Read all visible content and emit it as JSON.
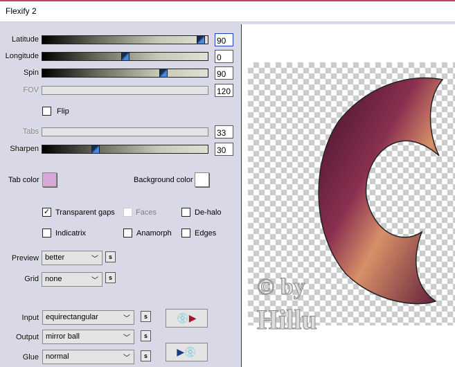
{
  "window": {
    "title": "Flexify 2"
  },
  "sliders": [
    {
      "label": "Latitude",
      "value": "90",
      "fraction": 0.98,
      "enabled": true
    },
    {
      "label": "Longitude",
      "value": "0",
      "fraction": 0.5,
      "enabled": true
    },
    {
      "label": "Spin",
      "value": "90",
      "fraction": 0.74,
      "enabled": true
    },
    {
      "label": "FOV",
      "value": "120",
      "enabled": false
    },
    {
      "label": "Tabs",
      "value": "33",
      "enabled": false
    },
    {
      "label": "Sharpen",
      "value": "30",
      "fraction": 0.31,
      "enabled": true
    }
  ],
  "flip": {
    "label": "Flip",
    "checked": false
  },
  "colors": {
    "tab_label": "Tab color",
    "tab_color": "#d8a8d8",
    "bg_label": "Background color",
    "bg_color": "#ffffff"
  },
  "checkboxes": [
    {
      "label": "Transparent gaps",
      "checked": true
    },
    {
      "label": "Faces",
      "checked": false,
      "disabled": true
    },
    {
      "label": "De-halo",
      "checked": false
    },
    {
      "label": "Indicatrix",
      "checked": false
    },
    {
      "label": "Anamorph",
      "checked": false
    },
    {
      "label": "Edges",
      "checked": false
    }
  ],
  "selects": {
    "preview": {
      "label": "Preview",
      "value": "better"
    },
    "grid": {
      "label": "Grid",
      "value": "none"
    },
    "input": {
      "label": "Input",
      "value": "equirectangular"
    },
    "output": {
      "label": "Output",
      "value": "mirror ball"
    },
    "glue": {
      "label": "Glue",
      "value": "normal"
    }
  },
  "s_label": "s",
  "watermark": "© by Hillu"
}
